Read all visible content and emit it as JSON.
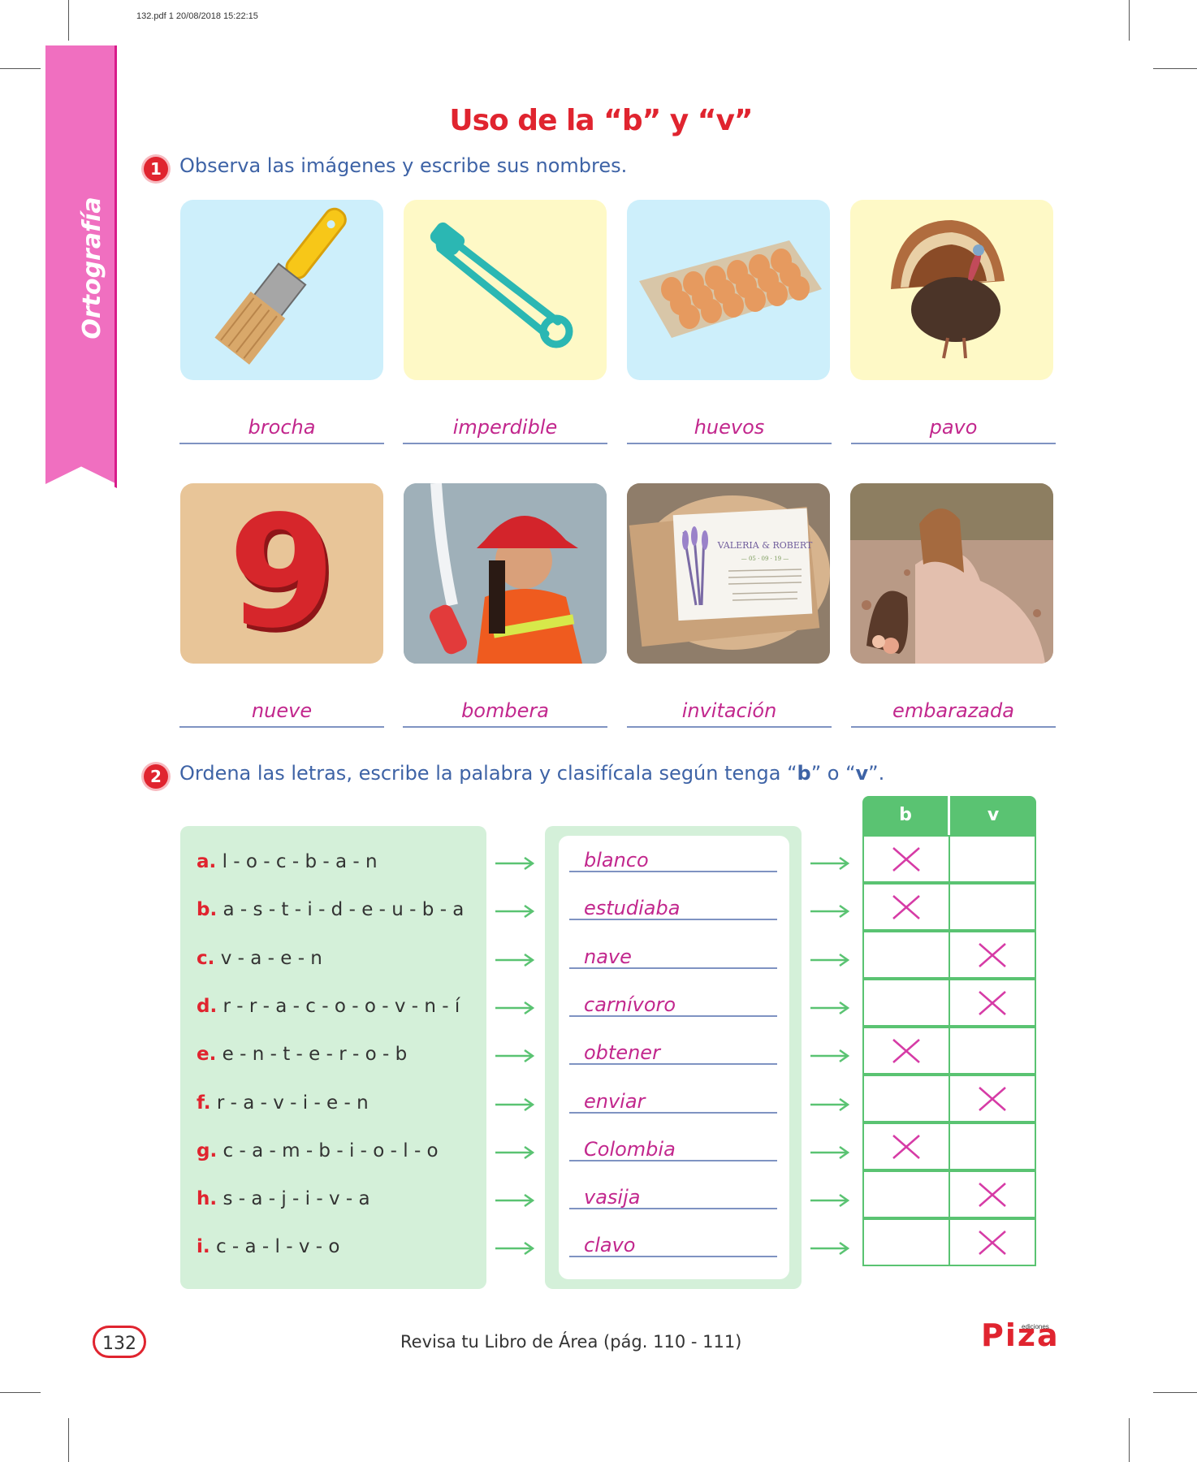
{
  "print_meta": "132.pdf  1  20/08/2018  15:22:15",
  "side_tab": {
    "label": "Ortografía"
  },
  "title": "Uso de la “b” y “v”",
  "section1": {
    "number": "1",
    "instruction": "Observa las imágenes y escribe sus nombres.",
    "cards": [
      {
        "answer": "brocha",
        "bg": "#cdeffb",
        "icon": "paintbrush-icon"
      },
      {
        "answer": "imperdible",
        "bg": "#fef9c6",
        "icon": "safety-pin-icon"
      },
      {
        "answer": "huevos",
        "bg": "#cdeffb",
        "icon": "egg-tray-icon"
      },
      {
        "answer": "pavo",
        "bg": "#fef9c6",
        "icon": "turkey-icon"
      },
      {
        "answer": "nueve",
        "bg": "#e8c598",
        "icon": "number-nine-icon",
        "glyph": "9"
      },
      {
        "answer": "bombera",
        "bg": "#9aa6ad",
        "icon": "firefighter-photo"
      },
      {
        "answer": "invitación",
        "bg": "#a58c6d",
        "icon": "invitation-card-photo",
        "card_heading": "VALERIA & ROBERT",
        "card_date": "— 05 · 09 · 19 —"
      },
      {
        "answer": "embarazada",
        "bg": "#c5a99a",
        "icon": "pregnant-woman-photo"
      }
    ]
  },
  "section2": {
    "number": "2",
    "instruction_pre": "Ordena las letras, escribe la palabra y clasifícala según tenga “",
    "instruction_b": "b",
    "instruction_mid": "” o “",
    "instruction_v": "v",
    "instruction_post": "”.",
    "table_headers": {
      "b": "b",
      "v": "v"
    },
    "rows": [
      {
        "label": "a.",
        "letters": "l - o - c - b - a - n",
        "word": "blanco",
        "mark": "b"
      },
      {
        "label": "b.",
        "letters": "a - s - t - i - d - e - u - b - a",
        "word": "estudiaba",
        "mark": "b"
      },
      {
        "label": "c.",
        "letters": "v - a - e - n",
        "word": "nave",
        "mark": "v"
      },
      {
        "label": "d.",
        "letters": "r - r - a - c - o - o - v - n - í",
        "word": "carnívoro",
        "mark": "v"
      },
      {
        "label": "e.",
        "letters": "e - n - t - e - r - o - b",
        "word": "obtener",
        "mark": "b"
      },
      {
        "label": "f.",
        "letters": "r - a - v - i - e - n",
        "word": "enviar",
        "mark": "v"
      },
      {
        "label": "g.",
        "letters": "c - a - m - b - i - o - l - o",
        "word": "Colombia",
        "mark": "b"
      },
      {
        "label": "h.",
        "letters": "s - a - j - i - v - a",
        "word": "vasija",
        "mark": "v"
      },
      {
        "label": "i.",
        "letters": "c - a - l - v - o",
        "word": "clavo",
        "mark": "v"
      }
    ]
  },
  "footer": {
    "page_number": "132",
    "text": "Revisa tu Libro de Área (pág. 110 - 111)",
    "logo": "Piza",
    "logo_small": "ediciones"
  },
  "colors": {
    "accent_red": "#e0242f",
    "magenta": "#c2278d",
    "pink_tab": "#f06fc0",
    "green": "#5ac372",
    "mint": "#d4f0d9",
    "blue_text": "#3e63a6"
  }
}
